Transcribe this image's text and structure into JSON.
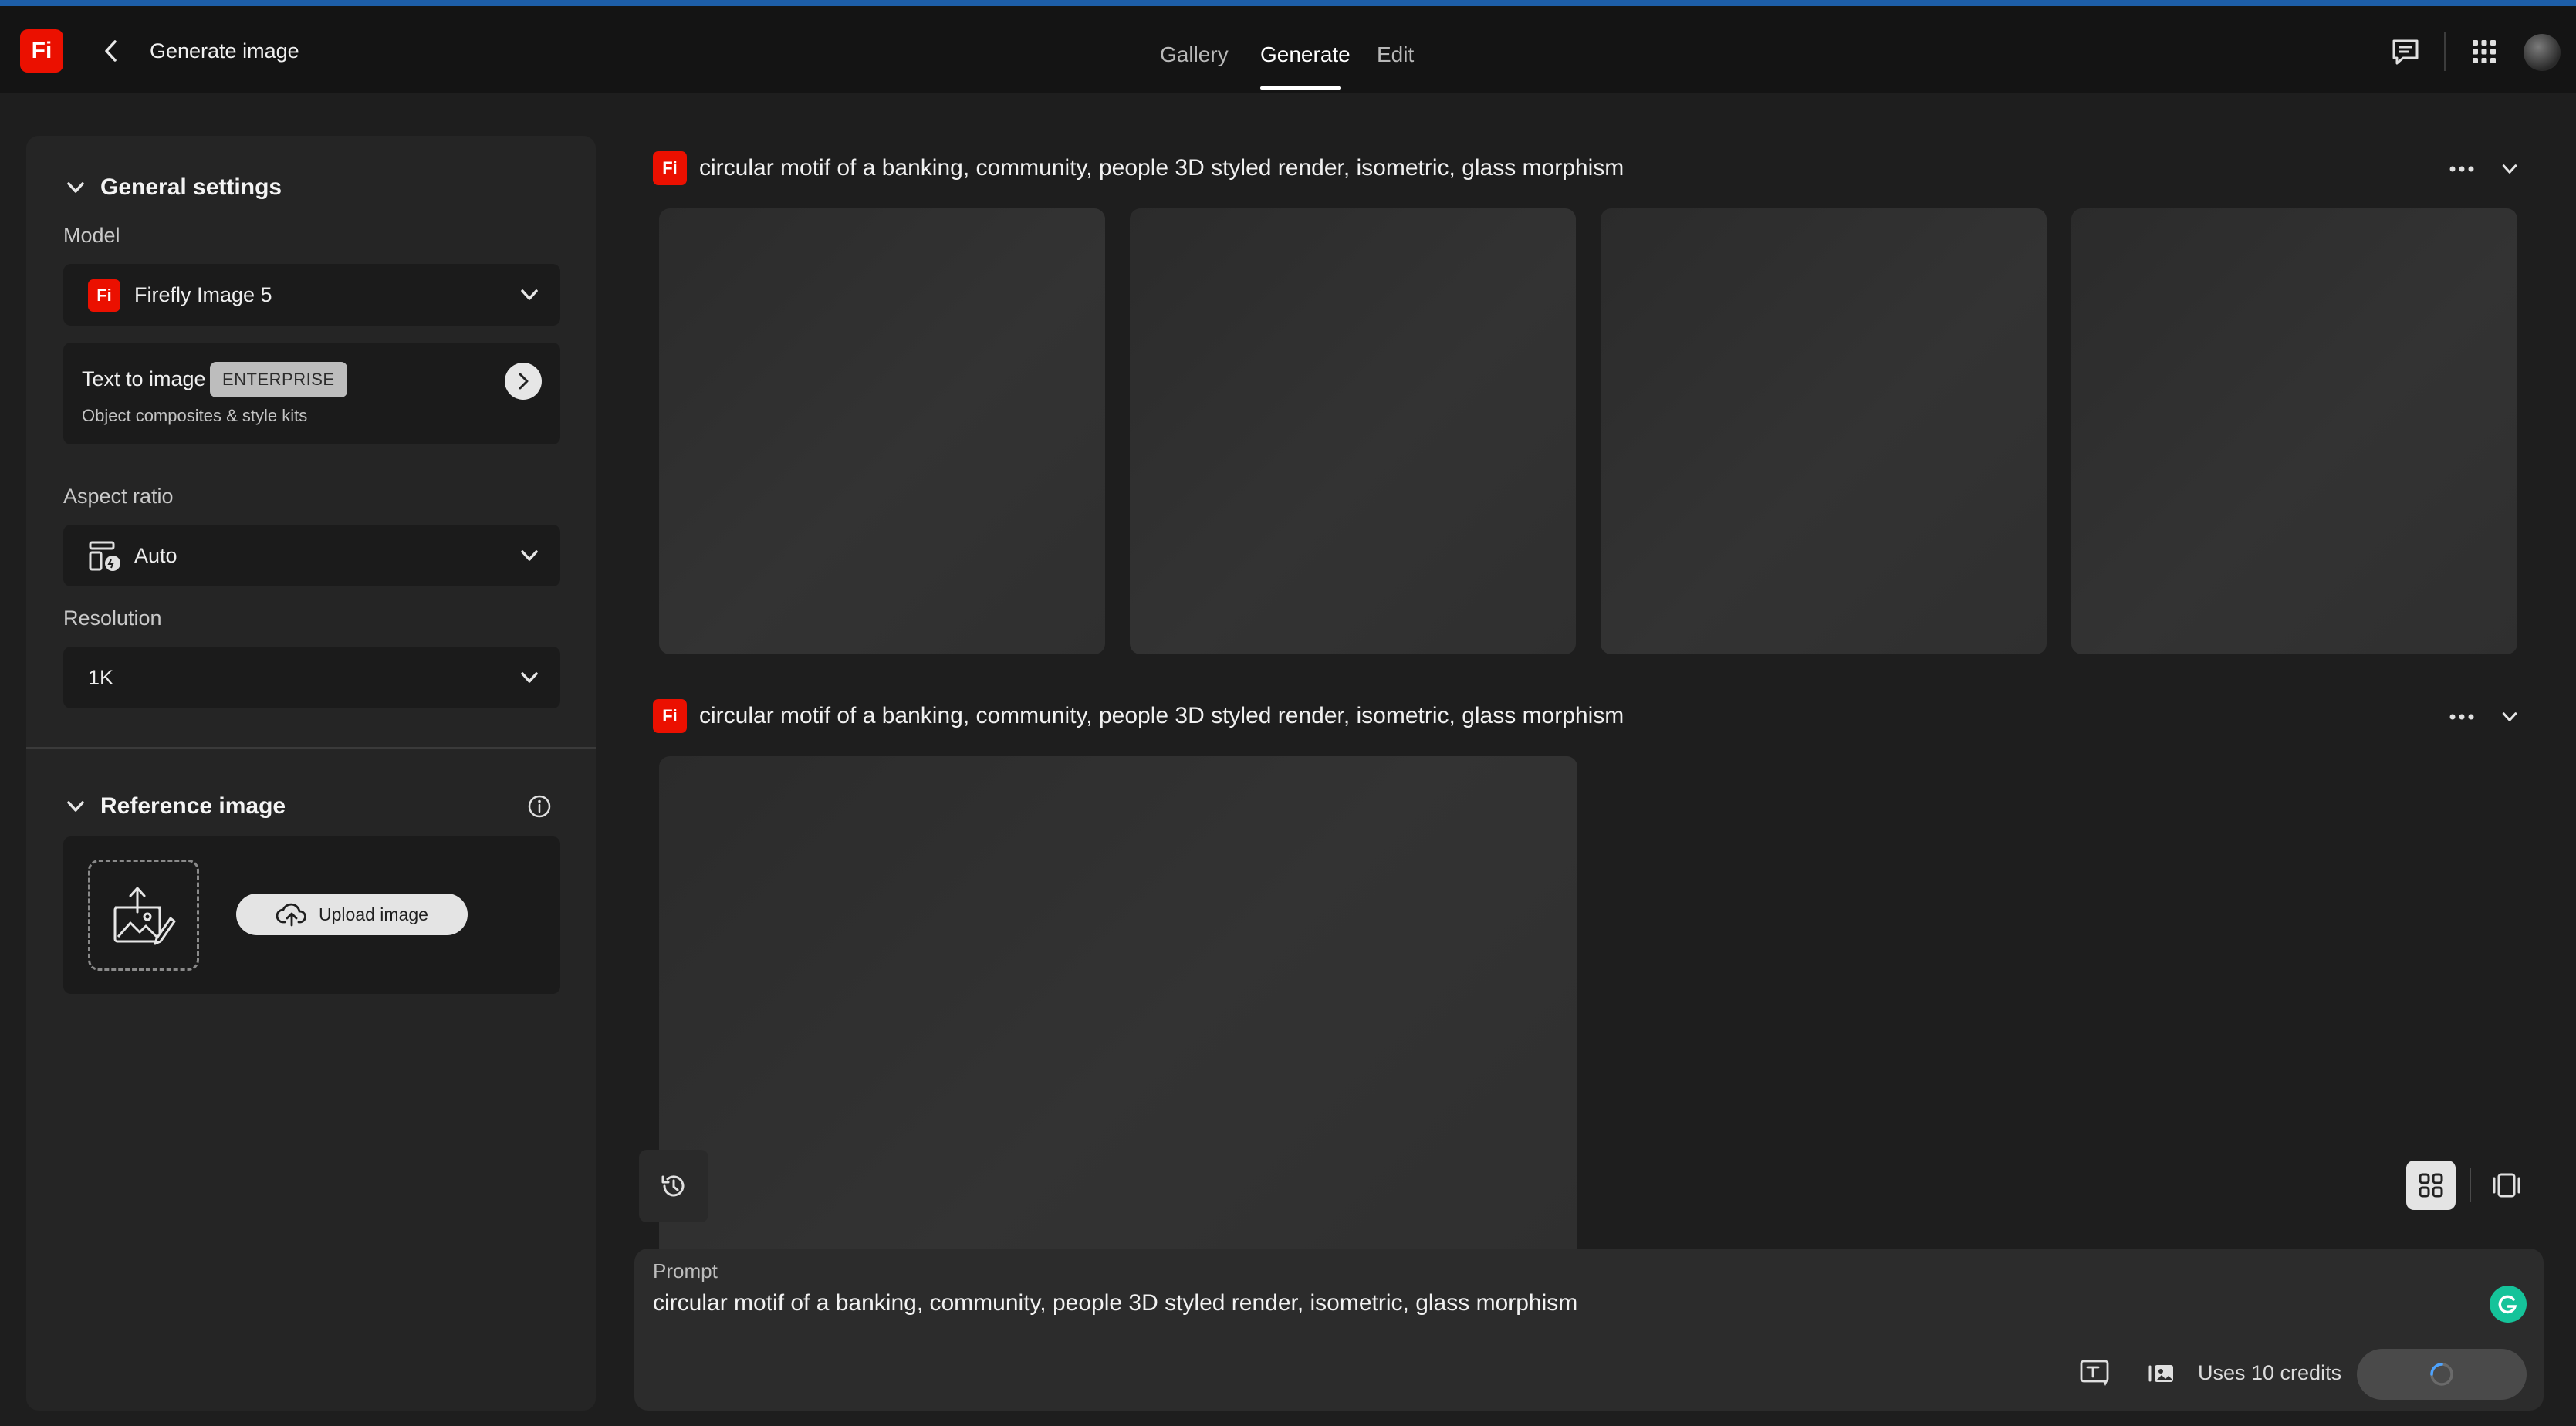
{
  "header": {
    "app_logo": "Fi",
    "title": "Generate image",
    "tabs": [
      {
        "label": "Gallery",
        "active": false
      },
      {
        "label": "Generate",
        "active": true
      },
      {
        "label": "Edit",
        "active": false
      }
    ],
    "icons": [
      "back-icon",
      "feedback-icon",
      "apps-grid-icon",
      "avatar"
    ]
  },
  "sidebar": {
    "general": {
      "title": "General settings",
      "model_label": "Model",
      "model_value": "Firefly Image 5",
      "model_logo": "Fi",
      "mode": {
        "title": "Text to image",
        "badge": "ENTERPRISE",
        "subtitle": "Object composites & style kits"
      },
      "aspect_label": "Aspect ratio",
      "aspect_value": "Auto",
      "resolution_label": "Resolution",
      "resolution_value": "1K"
    },
    "reference": {
      "title": "Reference image",
      "upload_label": "Upload image"
    }
  },
  "main": {
    "generations": [
      {
        "logo": "Fi",
        "prompt": "circular motif of a banking, community, people 3D styled render, isometric, glass morphism",
        "image_count": 4
      },
      {
        "logo": "Fi",
        "prompt": "circular motif of a banking, community, people 3D styled render, isometric, glass morphism",
        "image_count": 1
      }
    ]
  },
  "prompt_bar": {
    "label": "Prompt",
    "text": "circular motif of a banking, community, people 3D styled render, isometric, glass morphism",
    "credits": "Uses 10 credits"
  },
  "colors": {
    "brand": "#eb1000",
    "background": "#1e1e1e",
    "panel": "#252525",
    "header": "#141414",
    "grammarly": "#15c39a"
  }
}
